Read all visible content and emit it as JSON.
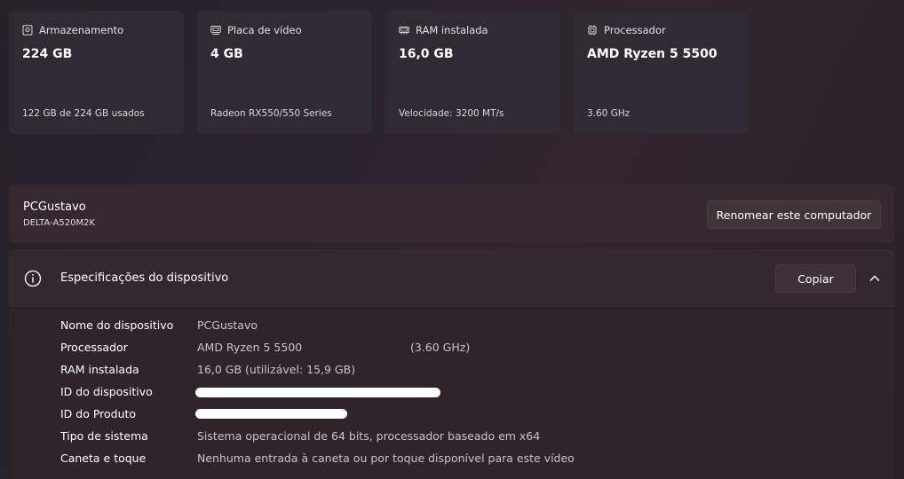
{
  "cards": [
    {
      "label": "Armazenamento",
      "value": "224 GB",
      "sub": "122 GB de 224 GB usados",
      "icon": "storage-icon"
    },
    {
      "label": "Placa de vídeo",
      "value": "4 GB",
      "sub": "Radeon RX550/550 Series",
      "icon": "gpu-icon"
    },
    {
      "label": "RAM instalada",
      "value": "16,0 GB",
      "sub": "Velocidade: 3200 MT/s",
      "icon": "ram-icon"
    },
    {
      "label": "Processador",
      "value": "AMD Ryzen 5 5500",
      "sub": "3.60 GHz",
      "icon": "cpu-icon"
    }
  ],
  "computer": {
    "name": "PCGustavo",
    "model": "DELTA-A520M2K",
    "rename_label": "Renomear este computador"
  },
  "specs": {
    "title": "Especificações do dispositivo",
    "copy_label": "Copiar",
    "rows": [
      {
        "key": "Nome do dispositivo",
        "value": "PCGustavo"
      },
      {
        "key": "Processador",
        "value": "AMD Ryzen 5 5500",
        "value2": "(3.60 GHz)"
      },
      {
        "key": "RAM instalada",
        "value": "16,0 GB (utilizável: 15,9 GB)"
      },
      {
        "key": "ID do dispositivo",
        "value": ""
      },
      {
        "key": "ID do Produto",
        "value": ""
      },
      {
        "key": "Tipo de sistema",
        "value": "Sistema operacional de 64 bits, processador baseado em x64"
      },
      {
        "key": "Caneta e toque",
        "value": "Nenhuma entrada à caneta ou por toque disponível para este vídeo"
      }
    ]
  },
  "colors": {
    "background": "#2a2128",
    "card": "#2f2a33",
    "accent_text": "#c9c3cc"
  }
}
